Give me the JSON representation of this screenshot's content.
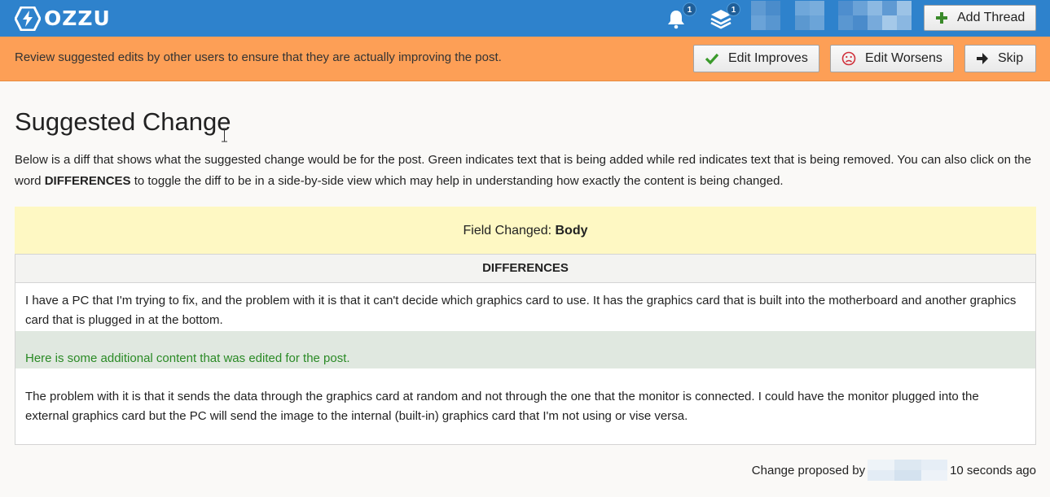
{
  "header": {
    "logo_text": "OZZU",
    "notifications_count": "1",
    "updates_count": "1",
    "add_thread_label": "Add Thread"
  },
  "banner": {
    "message": "Review suggested edits by other users to ensure that they are actually improving the post.",
    "improves_label": "Edit Improves",
    "worsens_label": "Edit Worsens",
    "skip_label": "Skip"
  },
  "main": {
    "title": "Suggested Change",
    "intro_before": "Below is a diff that shows what the suggested change would be for the post. Green indicates text that is being added while red indicates text that is being removed. You can also click on the word ",
    "intro_keyword": "DIFFERENCES",
    "intro_after": " to toggle the diff to be in a side-by-side view which may help in understanding how exactly the content is being changed.",
    "field_changed_label": "Field Changed: ",
    "field_changed_value": "Body",
    "diff_header": "DIFFERENCES",
    "diff_para_1": "I have a PC that I'm trying to fix, and the problem with it is that it can't decide which graphics card to use. It has the graphics card that is built into the motherboard and another graphics card that is plugged in at the bottom.",
    "diff_added": "Here is some additional content that was edited for the post.",
    "diff_para_2": "The problem with it is that it sends the data through the graphics card at random and not through the one that the monitor is connected. I could have the monitor plugged into the external graphics card but the PC will send the image to the internal (built-in) graphics card that I'm not using or vise versa."
  },
  "footer": {
    "proposed_by_label": "Change proposed by",
    "time_ago": "10 seconds ago"
  },
  "colors": {
    "topbar": "#2e82cc",
    "banner": "#fd9f56",
    "field_box": "#fef8c3",
    "added_bg": "#e0e8e0",
    "added_text": "#2a8a25"
  }
}
